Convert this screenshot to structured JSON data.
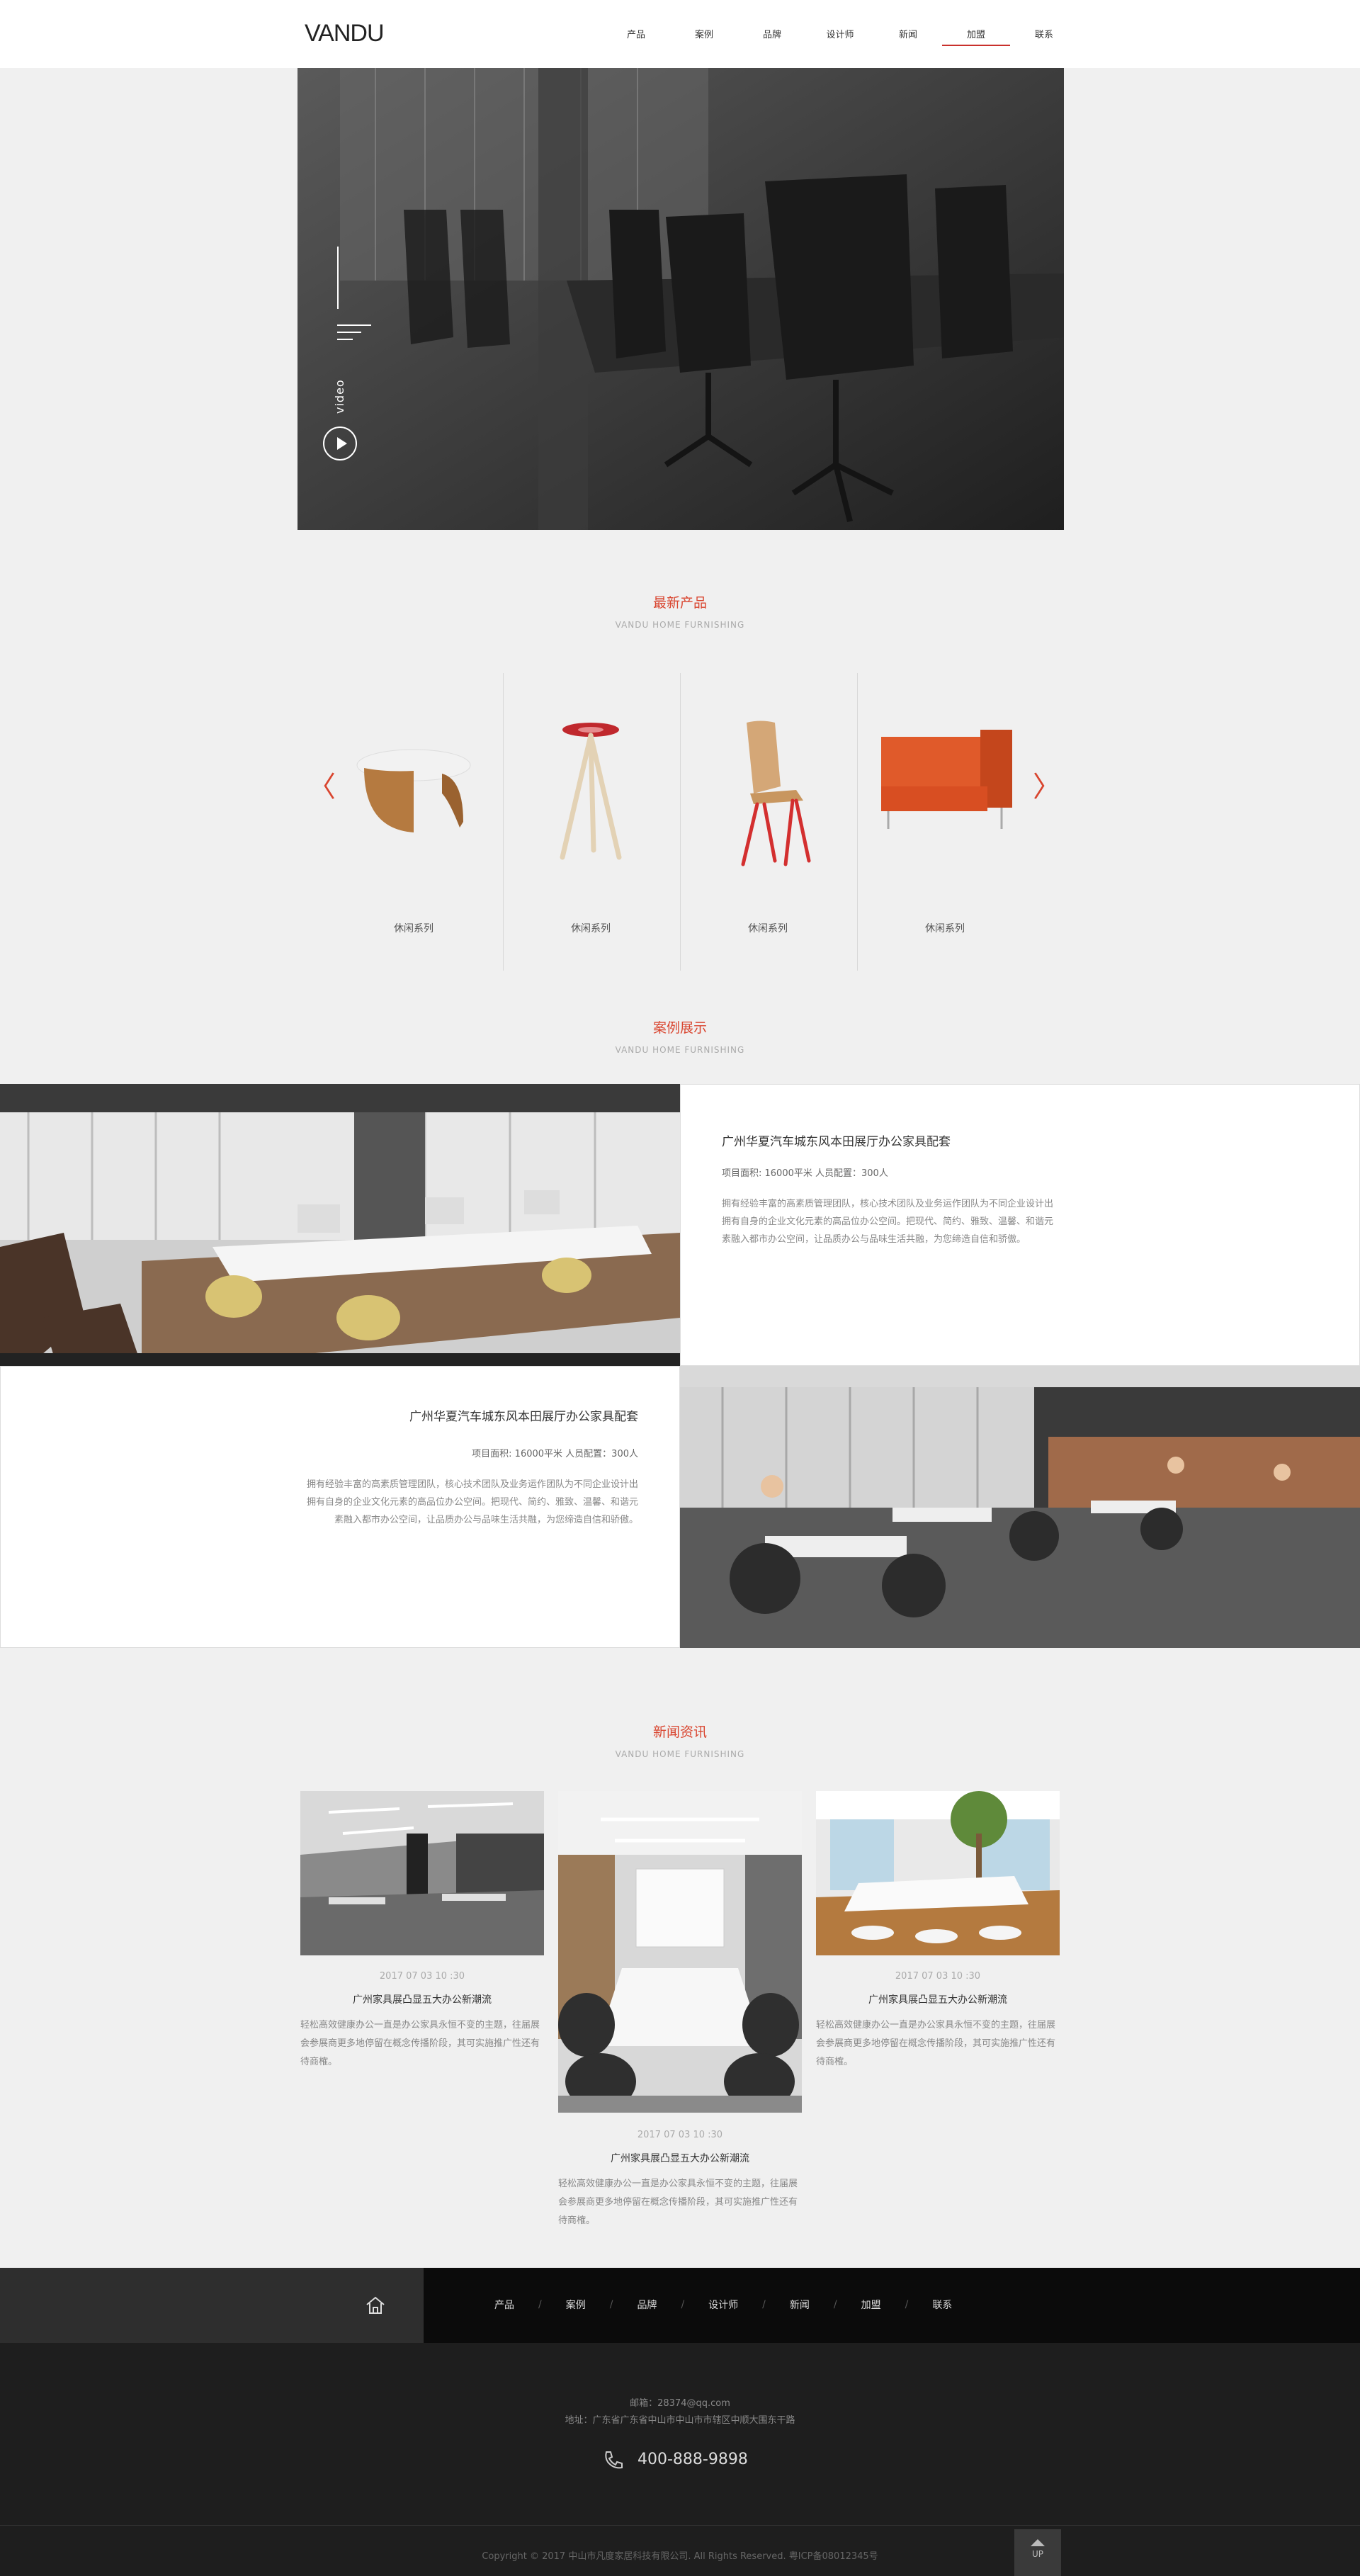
{
  "header": {
    "logo": "VANDU",
    "nav": [
      "产品",
      "案例",
      "品牌",
      "设计师",
      "新闻",
      "加盟",
      "联系"
    ]
  },
  "hero": {
    "video_label": "video"
  },
  "products_section": {
    "title": "最新产品",
    "subtitle": "VANDU HOME FURNISHING",
    "items": [
      {
        "label": "休闲系列",
        "icon": "round-table"
      },
      {
        "label": "休闲系列",
        "icon": "bar-stool"
      },
      {
        "label": "休闲系列",
        "icon": "wood-chair"
      },
      {
        "label": "休闲系列",
        "icon": "orange-sofa"
      }
    ]
  },
  "cases_section": {
    "title": "案例展示",
    "subtitle": "VANDU HOME FURNISHING",
    "cases": [
      {
        "title": "广州华夏汽车城东风本田展厅办公家具配套",
        "meta": "项目面积:   16000平米      人员配置：300人",
        "desc": "拥有经验丰富的高素质管理团队，核心技术团队及业务运作团队为不同企业设计出拥有自身的企业文化元素的高品位办公空间。把现代、简约、雅致、温馨、和谐元素融入都市办公空间，让品质办公与品味生活共融，为您缔造自信和骄傲。"
      },
      {
        "title": "广州华夏汽车城东风本田展厅办公家具配套",
        "meta": "项目面积:   16000平米      人员配置：300人",
        "desc": "拥有经验丰富的高素质管理团队，核心技术团队及业务运作团队为不同企业设计出拥有自身的企业文化元素的高品位办公空间。把现代、简约、雅致、温馨、和谐元素融入都市办公空间，让品质办公与品味生活共融，为您缔造自信和骄傲。"
      }
    ]
  },
  "news_section": {
    "title": "新闻资讯",
    "subtitle": "VANDU HOME FURNISHING",
    "items": [
      {
        "date": "2017 07 03 10 :30",
        "title": "广州家具展凸显五大办公新潮流",
        "desc": "轻松高效健康办公一直是办公家具永恒不变的主题，往届展会参展商更多地停留在概念传播阶段，其可实施推广性还有待商榷。"
      },
      {
        "date": "2017 07 03 10 :30",
        "title": "广州家具展凸显五大办公新潮流",
        "desc": "轻松高效健康办公一直是办公家具永恒不变的主题，往届展会参展商更多地停留在概念传播阶段，其可实施推广性还有待商榷。"
      },
      {
        "date": "2017 07 03 10 :30",
        "title": "广州家具展凸显五大办公新潮流",
        "desc": "轻松高效健康办公一直是办公家具永恒不变的主题，往届展会参展商更多地停留在概念传播阶段，其可实施推广性还有待商榷。"
      }
    ]
  },
  "footer_nav": {
    "home_icon": "home-icon",
    "links": [
      "产品",
      "案例",
      "品牌",
      "设计师",
      "新闻",
      "加盟",
      "联系"
    ],
    "separator": "/"
  },
  "footer": {
    "email": "邮箱：28374@qq.com",
    "address": "地址：广东省广东省中山市中山市市辖区中顺大围东干路",
    "phone": "400-888-9898",
    "copyright": "Copyright © 2017 中山市凡度家居科技有限公司. All Rights Reserved.    粤ICP备08012345号",
    "up_label": "UP"
  },
  "colors": {
    "accent": "#d9452f",
    "footer_dark": "#1e1e1e",
    "footer_nav": "#0b0b0b"
  }
}
